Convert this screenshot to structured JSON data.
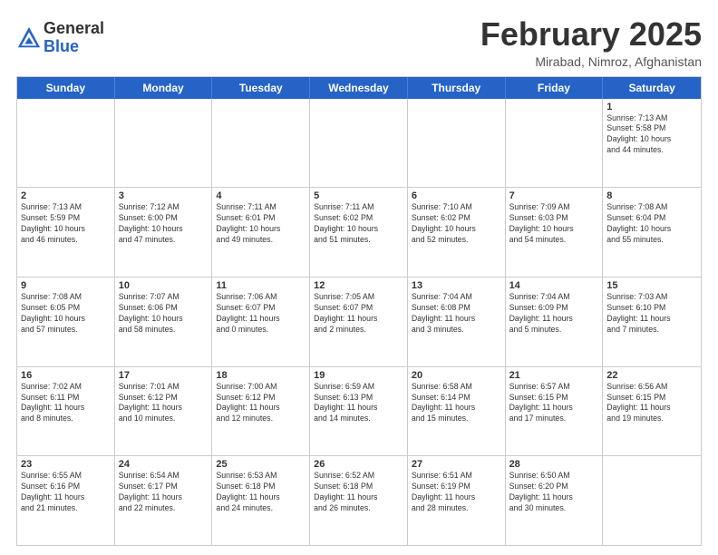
{
  "logo": {
    "general": "General",
    "blue": "Blue"
  },
  "title": "February 2025",
  "location": "Mirabad, Nimroz, Afghanistan",
  "header_days": [
    "Sunday",
    "Monday",
    "Tuesday",
    "Wednesday",
    "Thursday",
    "Friday",
    "Saturday"
  ],
  "weeks": [
    [
      {
        "day": "",
        "info": ""
      },
      {
        "day": "",
        "info": ""
      },
      {
        "day": "",
        "info": ""
      },
      {
        "day": "",
        "info": ""
      },
      {
        "day": "",
        "info": ""
      },
      {
        "day": "",
        "info": ""
      },
      {
        "day": "1",
        "info": "Sunrise: 7:13 AM\nSunset: 5:58 PM\nDaylight: 10 hours\nand 44 minutes."
      }
    ],
    [
      {
        "day": "2",
        "info": "Sunrise: 7:13 AM\nSunset: 5:59 PM\nDaylight: 10 hours\nand 46 minutes."
      },
      {
        "day": "3",
        "info": "Sunrise: 7:12 AM\nSunset: 6:00 PM\nDaylight: 10 hours\nand 47 minutes."
      },
      {
        "day": "4",
        "info": "Sunrise: 7:11 AM\nSunset: 6:01 PM\nDaylight: 10 hours\nand 49 minutes."
      },
      {
        "day": "5",
        "info": "Sunrise: 7:11 AM\nSunset: 6:02 PM\nDaylight: 10 hours\nand 51 minutes."
      },
      {
        "day": "6",
        "info": "Sunrise: 7:10 AM\nSunset: 6:02 PM\nDaylight: 10 hours\nand 52 minutes."
      },
      {
        "day": "7",
        "info": "Sunrise: 7:09 AM\nSunset: 6:03 PM\nDaylight: 10 hours\nand 54 minutes."
      },
      {
        "day": "8",
        "info": "Sunrise: 7:08 AM\nSunset: 6:04 PM\nDaylight: 10 hours\nand 55 minutes."
      }
    ],
    [
      {
        "day": "9",
        "info": "Sunrise: 7:08 AM\nSunset: 6:05 PM\nDaylight: 10 hours\nand 57 minutes."
      },
      {
        "day": "10",
        "info": "Sunrise: 7:07 AM\nSunset: 6:06 PM\nDaylight: 10 hours\nand 58 minutes."
      },
      {
        "day": "11",
        "info": "Sunrise: 7:06 AM\nSunset: 6:07 PM\nDaylight: 11 hours\nand 0 minutes."
      },
      {
        "day": "12",
        "info": "Sunrise: 7:05 AM\nSunset: 6:07 PM\nDaylight: 11 hours\nand 2 minutes."
      },
      {
        "day": "13",
        "info": "Sunrise: 7:04 AM\nSunset: 6:08 PM\nDaylight: 11 hours\nand 3 minutes."
      },
      {
        "day": "14",
        "info": "Sunrise: 7:04 AM\nSunset: 6:09 PM\nDaylight: 11 hours\nand 5 minutes."
      },
      {
        "day": "15",
        "info": "Sunrise: 7:03 AM\nSunset: 6:10 PM\nDaylight: 11 hours\nand 7 minutes."
      }
    ],
    [
      {
        "day": "16",
        "info": "Sunrise: 7:02 AM\nSunset: 6:11 PM\nDaylight: 11 hours\nand 8 minutes."
      },
      {
        "day": "17",
        "info": "Sunrise: 7:01 AM\nSunset: 6:12 PM\nDaylight: 11 hours\nand 10 minutes."
      },
      {
        "day": "18",
        "info": "Sunrise: 7:00 AM\nSunset: 6:12 PM\nDaylight: 11 hours\nand 12 minutes."
      },
      {
        "day": "19",
        "info": "Sunrise: 6:59 AM\nSunset: 6:13 PM\nDaylight: 11 hours\nand 14 minutes."
      },
      {
        "day": "20",
        "info": "Sunrise: 6:58 AM\nSunset: 6:14 PM\nDaylight: 11 hours\nand 15 minutes."
      },
      {
        "day": "21",
        "info": "Sunrise: 6:57 AM\nSunset: 6:15 PM\nDaylight: 11 hours\nand 17 minutes."
      },
      {
        "day": "22",
        "info": "Sunrise: 6:56 AM\nSunset: 6:15 PM\nDaylight: 11 hours\nand 19 minutes."
      }
    ],
    [
      {
        "day": "23",
        "info": "Sunrise: 6:55 AM\nSunset: 6:16 PM\nDaylight: 11 hours\nand 21 minutes."
      },
      {
        "day": "24",
        "info": "Sunrise: 6:54 AM\nSunset: 6:17 PM\nDaylight: 11 hours\nand 22 minutes."
      },
      {
        "day": "25",
        "info": "Sunrise: 6:53 AM\nSunset: 6:18 PM\nDaylight: 11 hours\nand 24 minutes."
      },
      {
        "day": "26",
        "info": "Sunrise: 6:52 AM\nSunset: 6:18 PM\nDaylight: 11 hours\nand 26 minutes."
      },
      {
        "day": "27",
        "info": "Sunrise: 6:51 AM\nSunset: 6:19 PM\nDaylight: 11 hours\nand 28 minutes."
      },
      {
        "day": "28",
        "info": "Sunrise: 6:50 AM\nSunset: 6:20 PM\nDaylight: 11 hours\nand 30 minutes."
      },
      {
        "day": "",
        "info": ""
      }
    ]
  ]
}
